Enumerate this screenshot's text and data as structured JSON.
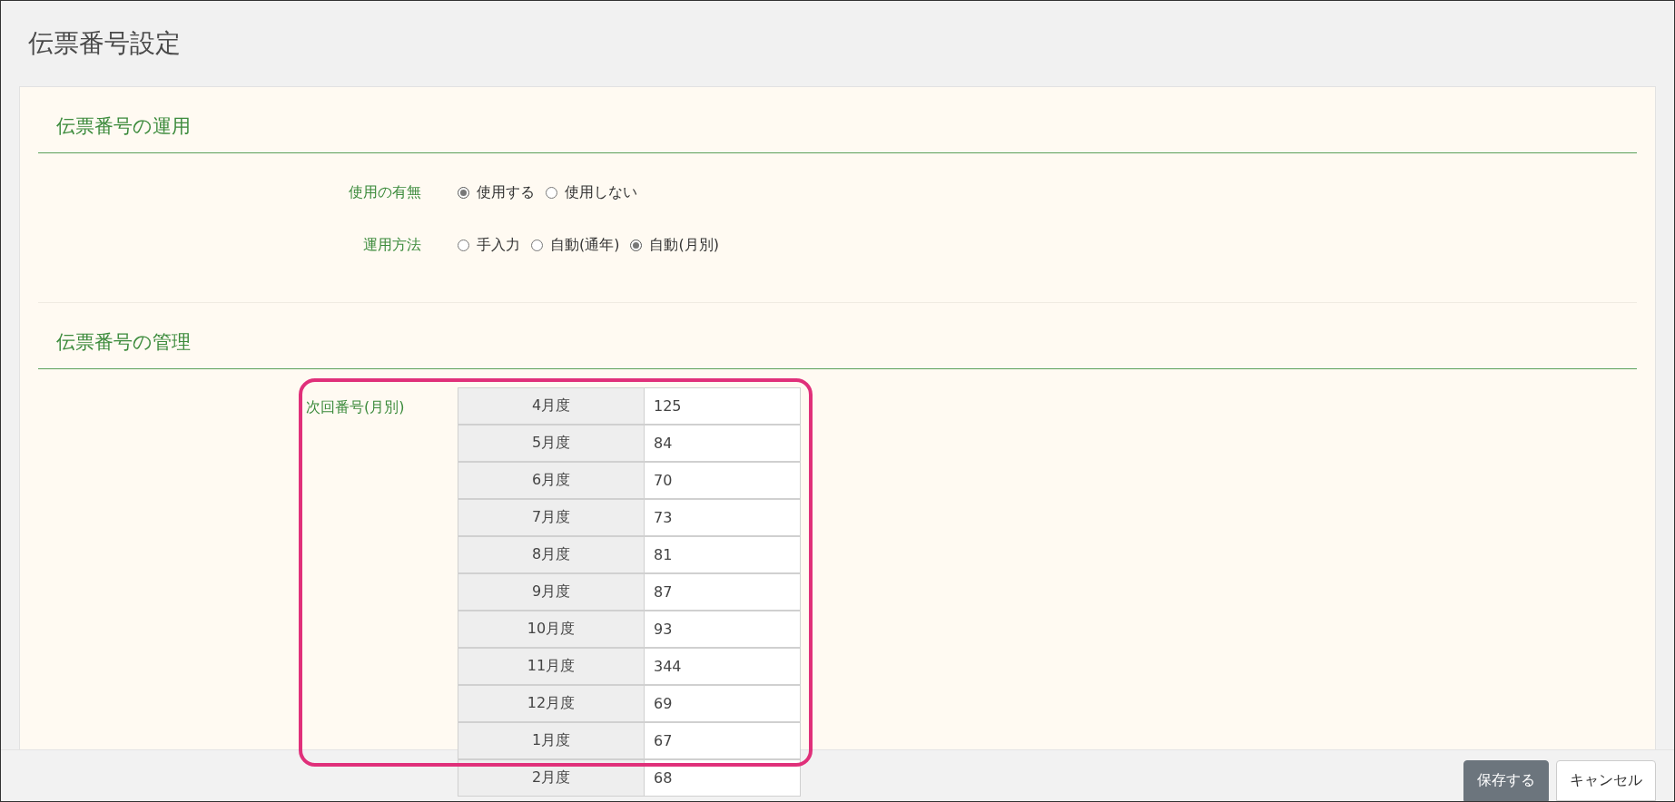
{
  "page": {
    "title": "伝票番号設定"
  },
  "sections": [
    {
      "title": "伝票番号の運用",
      "fields": [
        {
          "label": "使用の有無",
          "options": [
            {
              "label": "使用する",
              "selected": true
            },
            {
              "label": "使用しない",
              "selected": false
            }
          ]
        },
        {
          "label": "運用方法",
          "options": [
            {
              "label": "手入力",
              "selected": false
            },
            {
              "label": "自動(通年)",
              "selected": false
            },
            {
              "label": "自動(月別)",
              "selected": true
            }
          ]
        }
      ]
    },
    {
      "title": "伝票番号の管理",
      "next_numbers": {
        "label": "次回番号(月別)",
        "rows": [
          {
            "month": "4月度",
            "value": "125"
          },
          {
            "month": "5月度",
            "value": "84"
          },
          {
            "month": "6月度",
            "value": "70"
          },
          {
            "month": "7月度",
            "value": "73"
          },
          {
            "month": "8月度",
            "value": "81"
          },
          {
            "month": "9月度",
            "value": "87"
          },
          {
            "month": "10月度",
            "value": "93"
          },
          {
            "month": "11月度",
            "value": "344"
          },
          {
            "month": "12月度",
            "value": "69"
          },
          {
            "month": "1月度",
            "value": "67"
          },
          {
            "month": "2月度",
            "value": "68"
          }
        ]
      }
    }
  ],
  "buttons": [
    {
      "label": "保存する",
      "kind": "primary"
    },
    {
      "label": "キャンセル",
      "kind": "secondary"
    }
  ]
}
